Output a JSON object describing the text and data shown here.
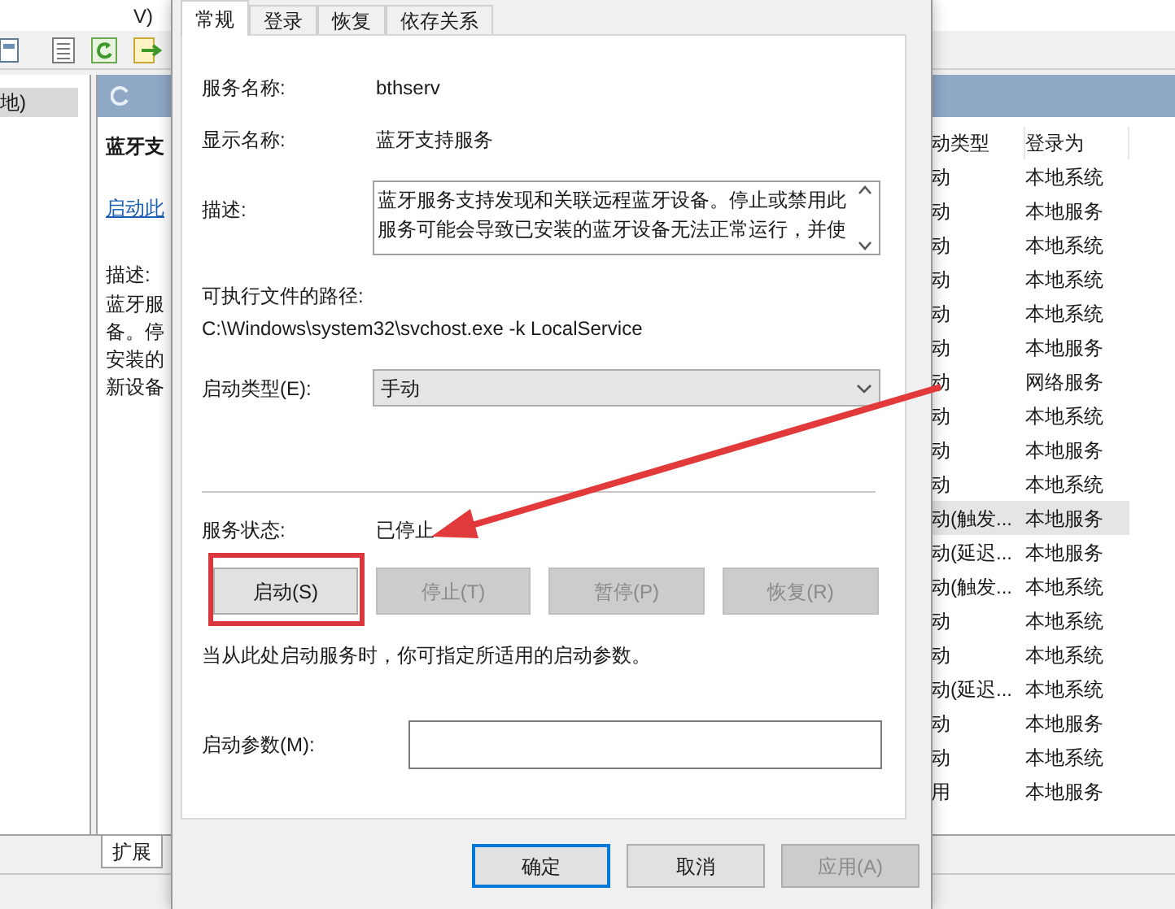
{
  "main_window": {
    "menu_fragment": "V)",
    "tree_item": {
      "label": "地)",
      "selected": true
    },
    "detail_pane": {
      "title": "蓝牙支",
      "link": "启动此",
      "description_label": "描述:",
      "description_lines": [
        "蓝牙服",
        "备。停",
        "安装的",
        "新设备"
      ]
    },
    "list": {
      "columns": [
        "动类型",
        "登录为"
      ],
      "rows": [
        {
          "column_1": "动",
          "logon": "本地系统",
          "selected": false
        },
        {
          "column_1": "动",
          "logon": "本地服务",
          "selected": false
        },
        {
          "column_1": "动",
          "logon": "本地系统",
          "selected": false
        },
        {
          "column_1": "动",
          "logon": "本地系统",
          "selected": false
        },
        {
          "column_1": "动",
          "logon": "本地系统",
          "selected": false
        },
        {
          "column_1": "动",
          "logon": "本地服务",
          "selected": false
        },
        {
          "column_1": "动",
          "logon": "网络服务",
          "selected": false
        },
        {
          "column_1": "动",
          "logon": "本地系统",
          "selected": false
        },
        {
          "column_1": "动",
          "logon": "本地服务",
          "selected": false
        },
        {
          "column_1": "动",
          "logon": "本地系统",
          "selected": false
        },
        {
          "column_1": "动(触发...",
          "logon": "本地服务",
          "selected": true
        },
        {
          "column_1": "动(延迟...",
          "logon": "本地服务",
          "selected": false
        },
        {
          "column_1": "动(触发...",
          "logon": "本地系统",
          "selected": false
        },
        {
          "column_1": "动",
          "logon": "本地系统",
          "selected": false
        },
        {
          "column_1": "动",
          "logon": "本地系统",
          "selected": false
        },
        {
          "column_1": "动(延迟...",
          "logon": "本地系统",
          "selected": false
        },
        {
          "column_1": "动",
          "logon": "本地服务",
          "selected": false
        },
        {
          "column_1": "动",
          "logon": "本地系统",
          "selected": false
        },
        {
          "column_1": "用",
          "logon": "本地服务",
          "selected": false
        }
      ]
    },
    "bottom_tabs": [
      {
        "label": "扩展",
        "selected": true
      }
    ]
  },
  "dialog": {
    "tabs": [
      {
        "label": "常规",
        "selected": true
      },
      {
        "label": "登录",
        "selected": false
      },
      {
        "label": "恢复",
        "selected": false
      },
      {
        "label": "依存关系",
        "selected": false
      }
    ],
    "service_name_label": "服务名称:",
    "service_name": "bthserv",
    "display_name_label": "显示名称:",
    "display_name": "蓝牙支持服务",
    "description_label": "描述:",
    "description": "蓝牙服务支持发现和关联远程蓝牙设备。停止或禁用此服务可能会导致已安装的蓝牙设备无法正常运行，并使",
    "path_label": "可执行文件的路径:",
    "path": "C:\\Windows\\system32\\svchost.exe -k LocalService",
    "startup_type_label": "启动类型(E):",
    "startup_type": "手动",
    "status_label": "服务状态:",
    "status": "已停止",
    "control_buttons": [
      {
        "label": "启动(S)",
        "disabled": false
      },
      {
        "label": "停止(T)",
        "disabled": true
      },
      {
        "label": "暂停(P)",
        "disabled": true
      },
      {
        "label": "恢复(R)",
        "disabled": true
      }
    ],
    "hint": "当从此处启动服务时，你可指定所适用的启动参数。",
    "parameters_label": "启动参数(M):",
    "footer_buttons": [
      {
        "label": "确定",
        "disabled": false,
        "default": true
      },
      {
        "label": "取消",
        "disabled": false,
        "default": false
      },
      {
        "label": "应用(A)",
        "disabled": true,
        "default": false
      }
    ]
  }
}
